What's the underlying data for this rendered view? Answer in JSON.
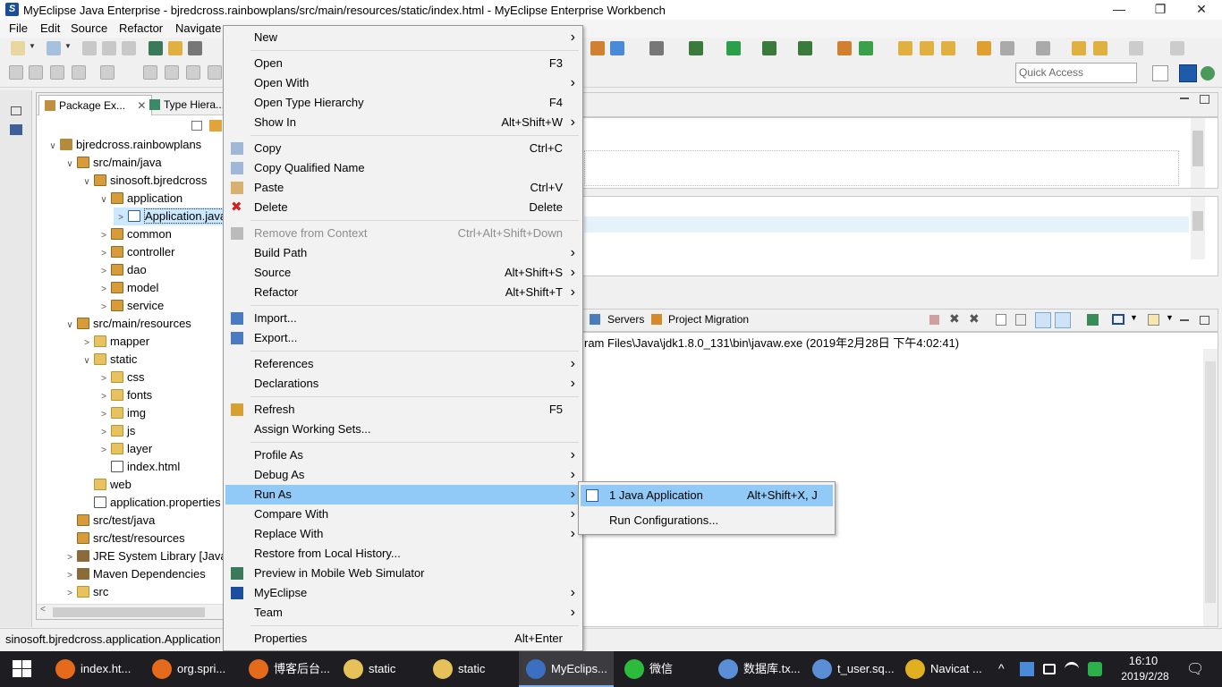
{
  "window": {
    "title": "MyEclipse Java Enterprise - bjredcross.rainbowplans/src/main/resources/static/index.html - MyEclipse Enterprise Workbench",
    "min": "—",
    "max": "❐",
    "close": "✕"
  },
  "menubar": [
    "File",
    "Edit",
    "Source",
    "Refactor",
    "Navigate"
  ],
  "quick_access": {
    "placeholder": "Quick Access"
  },
  "package_explorer": {
    "tabs": [
      "Package Ex...",
      "Type Hiera..."
    ],
    "tree": [
      {
        "label": "bjredcross.rainbowplans",
        "icon": "project-icon",
        "level": 0,
        "arrow": "∨"
      },
      {
        "label": "src/main/java",
        "icon": "source-folder-icon",
        "level": 1,
        "arrow": "∨"
      },
      {
        "label": "sinosoft.bjredcross",
        "icon": "package-icon",
        "level": 2,
        "arrow": "∨"
      },
      {
        "label": "application",
        "icon": "package-icon",
        "level": 3,
        "arrow": "∨"
      },
      {
        "label": "Application.java",
        "icon": "java-file-icon",
        "level": 4,
        "arrow": ">",
        "selected": true
      },
      {
        "label": "common",
        "icon": "package-icon",
        "level": 3,
        "arrow": ">"
      },
      {
        "label": "controller",
        "icon": "package-icon",
        "level": 3,
        "arrow": ">"
      },
      {
        "label": "dao",
        "icon": "package-icon",
        "level": 3,
        "arrow": ">"
      },
      {
        "label": "model",
        "icon": "package-icon",
        "level": 3,
        "arrow": ">"
      },
      {
        "label": "service",
        "icon": "package-icon",
        "level": 3,
        "arrow": ">"
      },
      {
        "label": "src/main/resources",
        "icon": "source-folder-icon",
        "level": 1,
        "arrow": "∨"
      },
      {
        "label": "mapper",
        "icon": "folder-icon",
        "level": 2,
        "arrow": ">"
      },
      {
        "label": "static",
        "icon": "folder-icon",
        "level": 2,
        "arrow": "∨"
      },
      {
        "label": "css",
        "icon": "folder-icon",
        "level": 3,
        "arrow": ">"
      },
      {
        "label": "fonts",
        "icon": "folder-icon",
        "level": 3,
        "arrow": ">"
      },
      {
        "label": "img",
        "icon": "folder-icon",
        "level": 3,
        "arrow": ">"
      },
      {
        "label": "js",
        "icon": "folder-icon",
        "level": 3,
        "arrow": ">"
      },
      {
        "label": "layer",
        "icon": "folder-icon",
        "level": 3,
        "arrow": ">"
      },
      {
        "label": "index.html",
        "icon": "html-file-icon",
        "level": 3,
        "arrow": ""
      },
      {
        "label": "web",
        "icon": "folder-icon",
        "level": 2,
        "arrow": ""
      },
      {
        "label": "application.properties",
        "icon": "properties-file-icon",
        "level": 2,
        "arrow": ""
      },
      {
        "label": "src/test/java",
        "icon": "source-folder-icon",
        "level": 1,
        "arrow": ""
      },
      {
        "label": "src/test/resources",
        "icon": "source-folder-icon",
        "level": 1,
        "arrow": ""
      },
      {
        "label": "JRE System Library [JavaSE-1.8]",
        "icon": "library-icon",
        "level": 1,
        "arrow": ">"
      },
      {
        "label": "Maven Dependencies",
        "icon": "library-icon",
        "level": 1,
        "arrow": ">"
      },
      {
        "label": "src",
        "icon": "folder-icon",
        "level": 1,
        "arrow": ">"
      }
    ]
  },
  "console": {
    "tabs": [
      "Servers",
      "Project Migration"
    ],
    "line": "ram Files\\Java\\jdk1.8.0_131\\bin\\javaw.exe (2019年2月28日 下午4:02:41)"
  },
  "context_menu": {
    "items": [
      {
        "label": "New",
        "submenu": true,
        "icon": ""
      },
      {
        "sep": true
      },
      {
        "label": "Open",
        "shortcut": "F3"
      },
      {
        "label": "Open With",
        "submenu": true
      },
      {
        "label": "Open Type Hierarchy",
        "shortcut": "F4"
      },
      {
        "label": "Show In",
        "shortcut": "Alt+Shift+W",
        "submenu": true
      },
      {
        "sep": true
      },
      {
        "label": "Copy",
        "shortcut": "Ctrl+C",
        "icon": "copy-icon"
      },
      {
        "label": "Copy Qualified Name",
        "icon": "copy-icon"
      },
      {
        "label": "Paste",
        "shortcut": "Ctrl+V",
        "icon": "paste-icon"
      },
      {
        "label": "Delete",
        "shortcut": "Delete",
        "icon": "delete-icon"
      },
      {
        "sep": true
      },
      {
        "label": "Remove from Context",
        "shortcut": "Ctrl+Alt+Shift+Down",
        "disabled": true,
        "icon": "remove-context-icon"
      },
      {
        "label": "Build Path",
        "submenu": true
      },
      {
        "label": "Source",
        "shortcut": "Alt+Shift+S",
        "submenu": true
      },
      {
        "label": "Refactor",
        "shortcut": "Alt+Shift+T",
        "submenu": true
      },
      {
        "sep": true
      },
      {
        "label": "Import...",
        "icon": "import-icon"
      },
      {
        "label": "Export...",
        "icon": "export-icon"
      },
      {
        "sep": true
      },
      {
        "label": "References",
        "submenu": true
      },
      {
        "label": "Declarations",
        "submenu": true
      },
      {
        "sep": true
      },
      {
        "label": "Refresh",
        "shortcut": "F5",
        "icon": "refresh-icon"
      },
      {
        "label": "Assign Working Sets..."
      },
      {
        "sep": true
      },
      {
        "label": "Profile As",
        "submenu": true
      },
      {
        "label": "Debug As",
        "submenu": true
      },
      {
        "label": "Run As",
        "submenu": true,
        "highlighted": true
      },
      {
        "label": "Compare With",
        "submenu": true
      },
      {
        "label": "Replace With",
        "submenu": true
      },
      {
        "label": "Restore from Local History..."
      },
      {
        "label": "Preview in Mobile Web Simulator",
        "icon": "mobile-preview-icon"
      },
      {
        "label": "MyEclipse",
        "submenu": true,
        "icon": "myeclipse-icon"
      },
      {
        "label": "Team",
        "submenu": true
      },
      {
        "sep": true
      },
      {
        "label": "Properties",
        "shortcut": "Alt+Enter"
      }
    ]
  },
  "run_as_submenu": {
    "items": [
      {
        "label": "1 Java Application",
        "shortcut": "Alt+Shift+X, J",
        "highlighted": true
      },
      {
        "label": "Run Configurations..."
      }
    ]
  },
  "statusbar": {
    "text": "sinosoft.bjredcross.application.Application.java - bjredcross.rainbowplans/src/main/java"
  },
  "taskbar": {
    "apps": [
      {
        "label": "index.ht...",
        "color": "#e56a1b"
      },
      {
        "label": "org.spri...",
        "color": "#e56a1b"
      },
      {
        "label": "博客后台...",
        "color": "#e56a1b"
      },
      {
        "label": "static",
        "color": "#e6c15a"
      },
      {
        "label": "static",
        "color": "#e6c15a"
      },
      {
        "label": "MyEclips...",
        "color": "#3b6fc1",
        "active": true
      },
      {
        "label": "微信",
        "color": "#2dbb3c"
      },
      {
        "label": "数据库.tx...",
        "color": "#5a8fd8"
      },
      {
        "label": "t_user.sq...",
        "color": "#5a8fd8"
      },
      {
        "label": "Navicat ...",
        "color": "#e0b020"
      }
    ],
    "clock_time": "16:10",
    "clock_date": "2019/2/28",
    "tray_chevron": "^",
    "notif": "🗨"
  }
}
